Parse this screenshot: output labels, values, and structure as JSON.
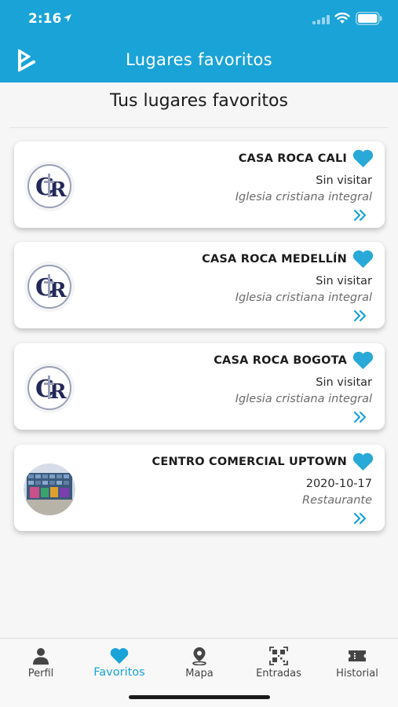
{
  "status_bar": {
    "time": "2:16"
  },
  "header": {
    "title": "Lugares favoritos"
  },
  "section_title": "Tus lugares favoritos",
  "colors": {
    "accent": "#1aa3d7",
    "heart": "#29a9d8"
  },
  "places": [
    {
      "name": "CASA ROCA CALI",
      "status": "Sin visitar",
      "category": "Iglesia cristiana integral",
      "avatar": "casa-roca-logo"
    },
    {
      "name": "CASA ROCA MEDELLÍN",
      "status": "Sin visitar",
      "category": "Iglesia cristiana integral",
      "avatar": "casa-roca-logo"
    },
    {
      "name": "CASA ROCA BOGOTA",
      "status": "Sin visitar",
      "category": "Iglesia cristiana integral",
      "avatar": "casa-roca-logo"
    },
    {
      "name": "CENTRO COMERCIAL UPTOWN",
      "status": "2020-10-17",
      "category": "Restaurante",
      "avatar": "building-photo"
    }
  ],
  "nav": {
    "items": [
      {
        "label": "Perfil",
        "icon": "person-icon"
      },
      {
        "label": "Favoritos",
        "icon": "heart-icon"
      },
      {
        "label": "Mapa",
        "icon": "map-pin-icon"
      },
      {
        "label": "Entradas",
        "icon": "qr-code-icon"
      },
      {
        "label": "Historial",
        "icon": "ticket-icon"
      }
    ],
    "active": "Favoritos"
  }
}
